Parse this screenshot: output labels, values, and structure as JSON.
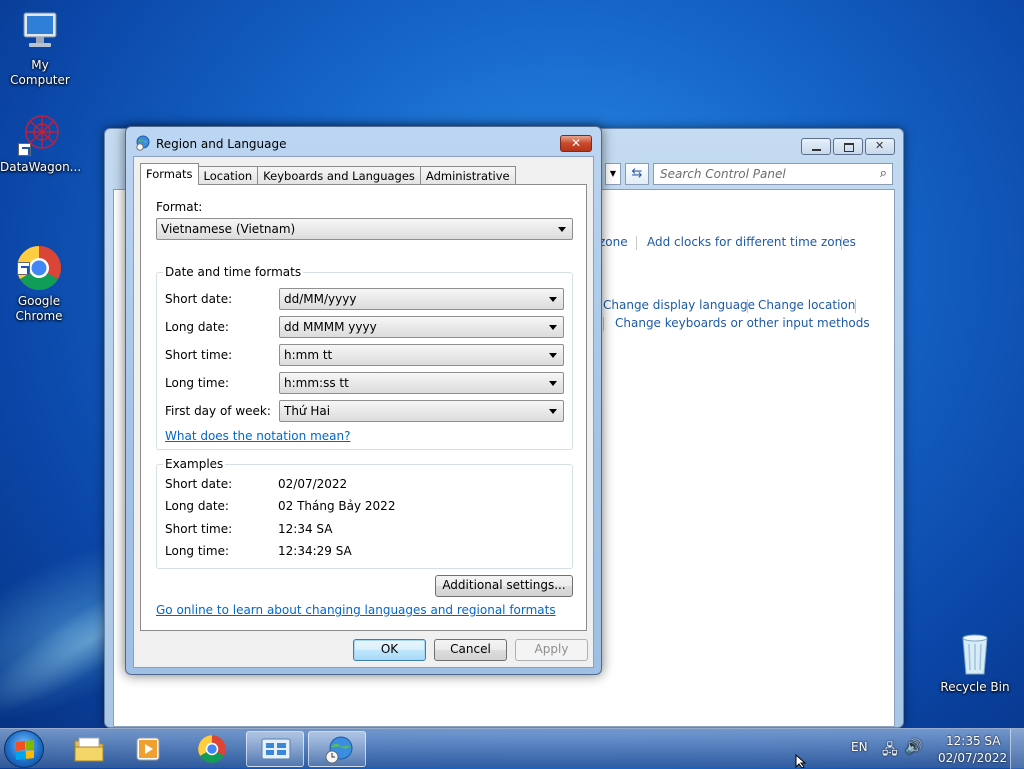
{
  "desktop": {
    "icons": [
      {
        "label": "My Computer"
      },
      {
        "label": "DataWagon..."
      },
      {
        "label": "Google\nChrome"
      },
      {
        "label": "Recycle Bin"
      }
    ]
  },
  "control_panel": {
    "search_placeholder": "Search Control Panel",
    "links": {
      "zone": "zone",
      "add_clocks": "Add clocks for different time zones",
      "change_display_language": "Change display language",
      "change_location": "Change location",
      "change_keyboards": "Change keyboards or other input methods"
    }
  },
  "dialog": {
    "title": "Region and Language",
    "close_label": "✕",
    "tabs": [
      {
        "label": "Formats",
        "active": true
      },
      {
        "label": "Location",
        "active": false
      },
      {
        "label": "Keyboards and Languages",
        "active": false
      },
      {
        "label": "Administrative",
        "active": false
      }
    ],
    "format_label": "Format:",
    "format_value": "Vietnamese (Vietnam)",
    "datetime_group_title": "Date and time formats",
    "datetime_rows": [
      {
        "label": "Short date:",
        "value": "dd/MM/yyyy"
      },
      {
        "label": "Long date:",
        "value": "dd MMMM yyyy"
      },
      {
        "label": "Short time:",
        "value": "h:mm tt"
      },
      {
        "label": "Long time:",
        "value": "h:mm:ss tt"
      },
      {
        "label": "First day of week:",
        "value": "Thứ Hai"
      }
    ],
    "notation_link": "What does the notation mean?",
    "examples_group_title": "Examples",
    "examples": [
      {
        "label": "Short date:",
        "value": "02/07/2022"
      },
      {
        "label": "Long date:",
        "value": "02 Tháng Bảy 2022"
      },
      {
        "label": "Short time:",
        "value": "12:34 SA"
      },
      {
        "label": "Long time:",
        "value": "12:34:29 SA"
      }
    ],
    "additional_settings": "Additional settings...",
    "online_link": "Go online to learn about changing languages and regional formats",
    "ok": "OK",
    "cancel": "Cancel",
    "apply": "Apply"
  },
  "taskbar": {
    "language": "EN",
    "time": "12:35 SA",
    "date": "02/07/2022"
  },
  "colors": {
    "link": "#0066cc",
    "desktop_blue": "#1565c8"
  }
}
